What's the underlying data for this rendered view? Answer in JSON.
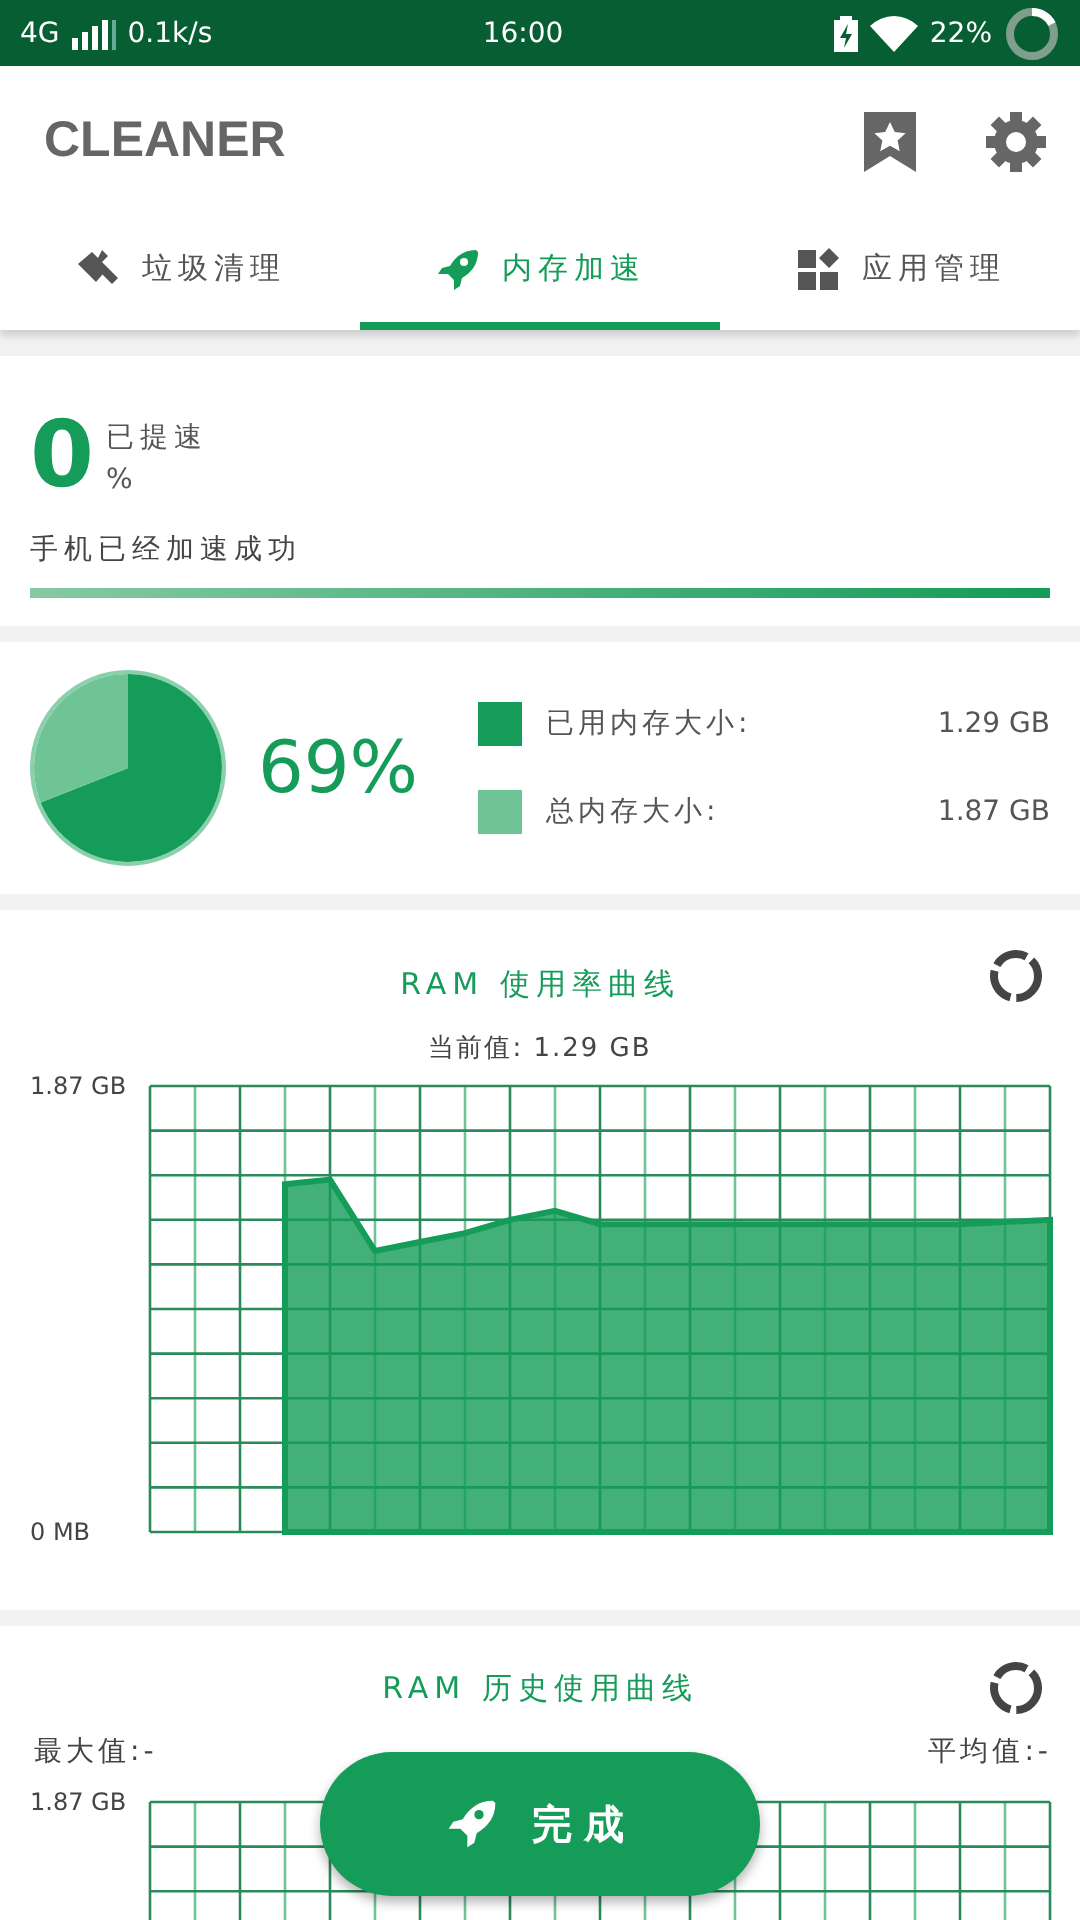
{
  "status_bar": {
    "network": "4G",
    "speed": "0.1k/s",
    "time": "16:00",
    "battery": "22%"
  },
  "app_bar": {
    "title": "CLEANER"
  },
  "tabs": [
    {
      "label": "垃圾清理",
      "selected": false,
      "kind": "broom"
    },
    {
      "label": "内存加速",
      "selected": true,
      "kind": "rocket"
    },
    {
      "label": "应用管理",
      "selected": false,
      "kind": "apps"
    }
  ],
  "boost": {
    "value": "0",
    "caption": "已提速",
    "unit": "%",
    "message": "手机已经加速成功",
    "level": 1
  },
  "memory": {
    "chart_data": {
      "type": "pie",
      "values": [
        69,
        31
      ]
    },
    "percent": "69%",
    "legend": [
      {
        "label": "已用内存大小:",
        "value": "1.29 GB",
        "color": "#149c58"
      },
      {
        "label": "总内存大小:",
        "value": "1.87 GB",
        "color": "#6fc496"
      }
    ]
  },
  "ram_chart": {
    "title": "RAM 使用率曲线",
    "current": "当前值: 1.29 GB",
    "y_max_label": "1.87 GB",
    "y_min_label": "0 MB"
  },
  "history_chart": {
    "title": "RAM 历史使用曲线",
    "max": "最大值:-",
    "avg": "平均值:-",
    "y_label": "1.87 GB"
  },
  "done_button": {
    "label": "完成"
  }
}
